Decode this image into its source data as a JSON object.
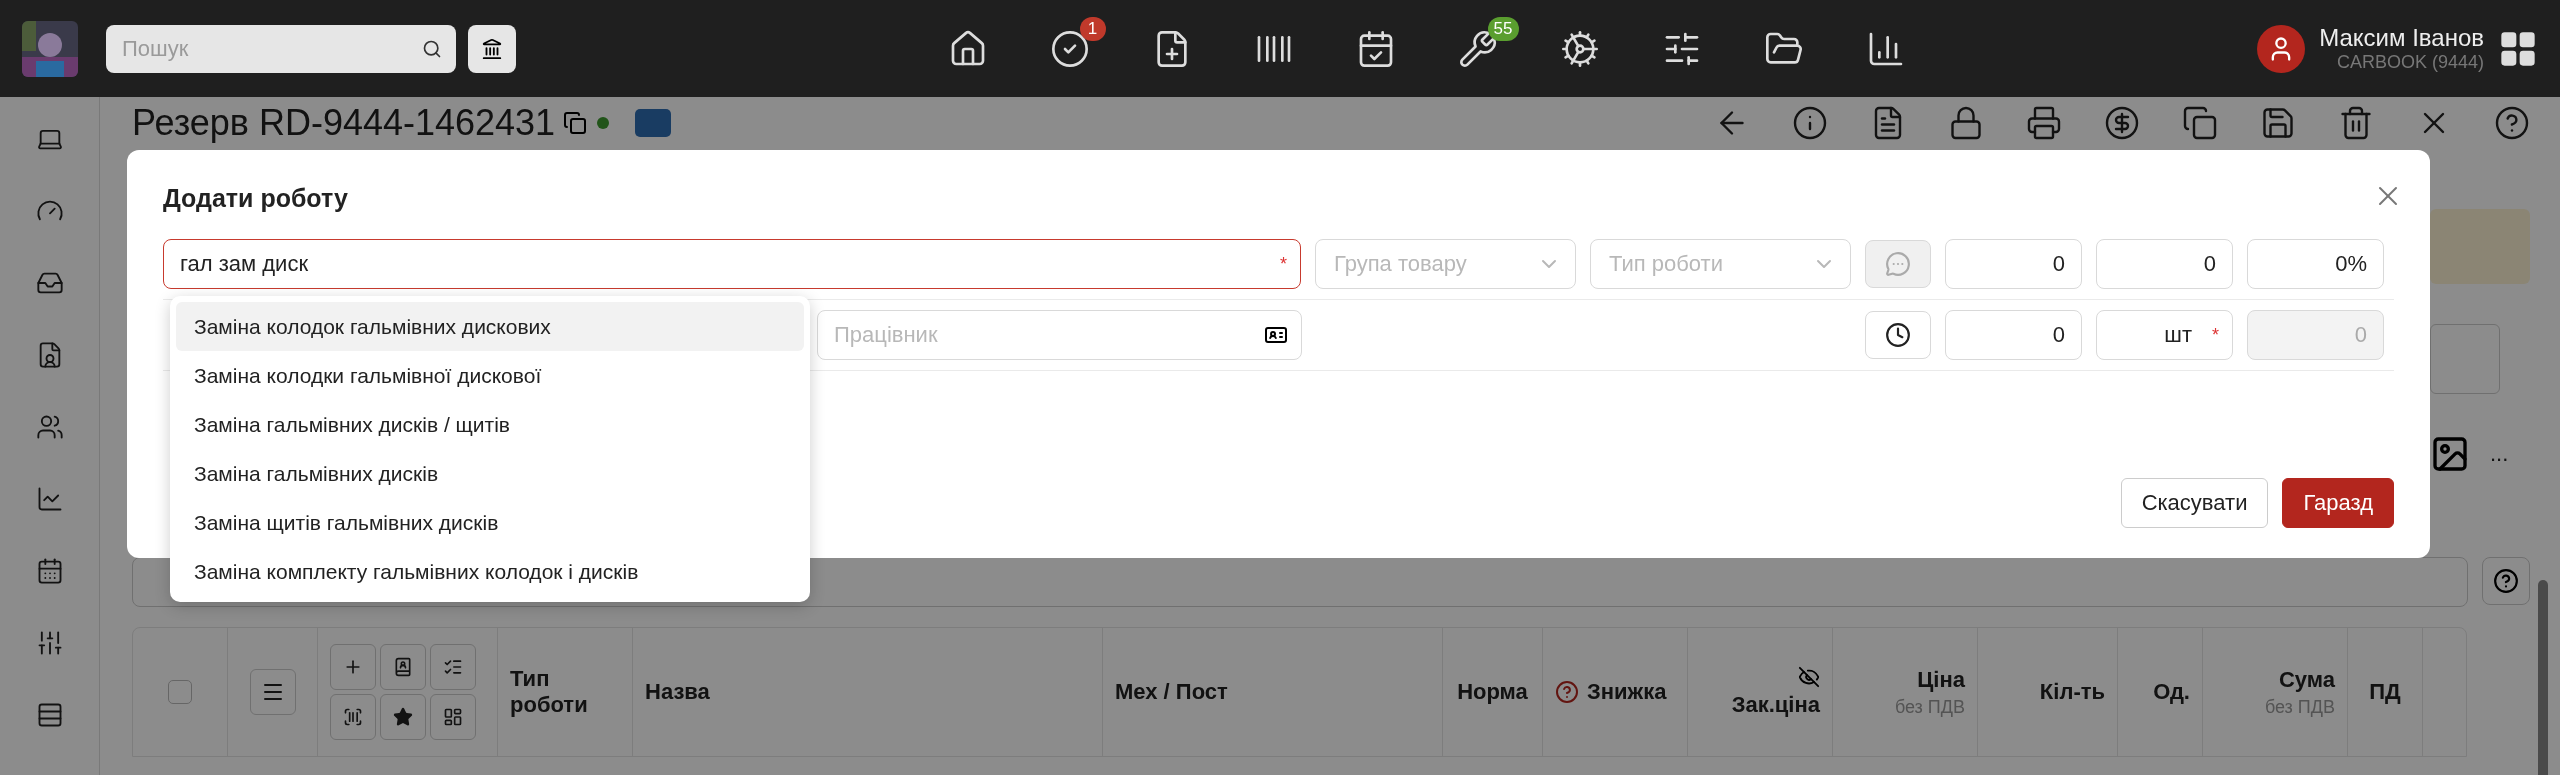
{
  "topbar": {
    "search": {
      "placeholder": "Пошук"
    },
    "nav": [
      {
        "kind": "home"
      },
      {
        "kind": "tasks",
        "badge": "1",
        "color": "#c0392b"
      },
      {
        "kind": "new"
      },
      {
        "kind": "barcode"
      },
      {
        "kind": "calendar"
      },
      {
        "kind": "repair",
        "badge": "55",
        "color": "#5a9e2f"
      },
      {
        "kind": "settings"
      },
      {
        "kind": "sliders"
      },
      {
        "kind": "folder"
      },
      {
        "kind": "chart"
      }
    ],
    "user": {
      "name": "Максим Іванов",
      "company": "CARBOOK (9444)"
    }
  },
  "page": {
    "title": "Резерв RD-9444-1462431",
    "more": "..."
  },
  "modal": {
    "title": "Додати роботу",
    "name_field": {
      "value": "гал зам диск",
      "required_mark": "*"
    },
    "group_select": {
      "placeholder": "Група товару"
    },
    "type_select": {
      "placeholder": "Тип роботи"
    },
    "row1_values": [
      "0",
      "0",
      "0%"
    ],
    "worker_field": {
      "placeholder": "Працівник"
    },
    "hours": "0",
    "unit": {
      "value": "шт",
      "required_mark": "*"
    },
    "total": {
      "value": "0",
      "disabled": true
    },
    "buttons": [
      {
        "label": "Скасувати",
        "kind": "secondary"
      },
      {
        "label": "Гаразд",
        "kind": "primary"
      }
    ]
  },
  "dropdown": [
    {
      "label": "Заміна колодок гальмівних дискових",
      "selected": true
    },
    {
      "label": "Заміна колодки гальмівної дискової",
      "selected": false
    },
    {
      "label": "Заміна гальмівних дисків / щитів",
      "selected": false
    },
    {
      "label": "Заміна гальмівних дисків",
      "selected": false
    },
    {
      "label": "Заміна щитів гальмівних дисків",
      "selected": false
    },
    {
      "label": "Заміна комплекту гальмівних колодок і дисків",
      "selected": false
    }
  ],
  "table": {
    "select_all": {
      "checked": false
    },
    "columns": [
      {
        "label": "Тип роботи",
        "kind": "plain"
      },
      {
        "label": "Назва",
        "kind": "plain"
      },
      {
        "label": "Мех / Пост",
        "kind": "plain"
      },
      {
        "label": "Норма",
        "kind": "plain"
      },
      {
        "label": "Знижка",
        "kind": "help"
      },
      {
        "label": "Зак.ціна",
        "kind": "hidden"
      },
      {
        "label": "Ціна",
        "sub": "без ПДВ",
        "kind": "plain"
      },
      {
        "label": "Кіл-ть",
        "kind": "plain"
      },
      {
        "label": "Од.",
        "kind": "plain"
      },
      {
        "label": "Сума",
        "sub": "без ПДВ",
        "kind": "plain"
      },
      {
        "label": "ПД",
        "kind": "plain"
      }
    ]
  }
}
